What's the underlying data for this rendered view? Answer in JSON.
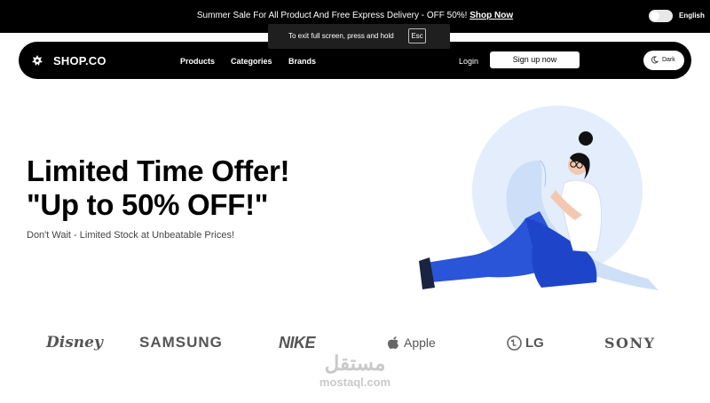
{
  "announcement": {
    "text": "Summer Sale For All Product And Free Express Delivery - OFF 50%! ",
    "link": "Shop Now"
  },
  "language": "English",
  "fullscreen_notice": {
    "text": "To exit full screen, press and hold",
    "key": "Esc"
  },
  "nav": {
    "logo": "SHOP.CO",
    "links": [
      "Products",
      "Categories",
      "Brands"
    ],
    "login": "Login",
    "signup": "Sign up now",
    "theme_toggle": "Dark"
  },
  "hero": {
    "title_line1": "Limited Time Offer!",
    "title_line2": "\"Up to 50% OFF!\"",
    "subtitle": "Don't Wait - Limited Stock at Unbeatable Prices!"
  },
  "brands": [
    "Disney",
    "SAMSUNG",
    "NIKE",
    "Apple",
    "LG",
    "SONY"
  ],
  "watermark": {
    "arabic": "مستقل",
    "latin": "mostaql.com"
  },
  "colors": {
    "primary": "#000000",
    "accent_blue": "#2450d6",
    "circle_bg": "#e3edfb"
  }
}
